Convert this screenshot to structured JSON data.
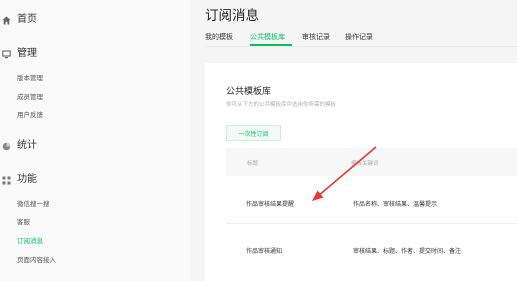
{
  "sidebar": {
    "sections": [
      {
        "label": "首页",
        "icon": "home-icon"
      },
      {
        "label": "管理",
        "icon": "monitor-icon"
      },
      {
        "label": "统计",
        "icon": "pie-chart-icon"
      },
      {
        "label": "功能",
        "icon": "grid-icon"
      }
    ],
    "manage_items": [
      "版本管理",
      "成员管理",
      "用户反馈"
    ],
    "feature_items": [
      "微信搜一搜",
      "客服",
      "订阅消息",
      "页面内容接入"
    ],
    "active_item": "订阅消息"
  },
  "page": {
    "title": "订阅消息",
    "tabs": [
      "我的模板",
      "公共模板库",
      "审核记录",
      "操作记录"
    ],
    "active_tab": "公共模板库"
  },
  "library": {
    "title": "公共模板库",
    "description": "你可从下方的公共模板库中选用你所需的模板",
    "button_label": "一次性订阅",
    "columns": [
      "标题",
      "模板关键词"
    ],
    "rows": [
      {
        "title": "作品审核结果提醒",
        "keywords": "作品名称、审核结果、温馨提示"
      },
      {
        "title": "作品审核通知",
        "keywords": "审核结果、标题、作者、提交时间、备注"
      }
    ]
  },
  "colors": {
    "accent": "#07c160",
    "annotation_arrow": "#e53935"
  }
}
